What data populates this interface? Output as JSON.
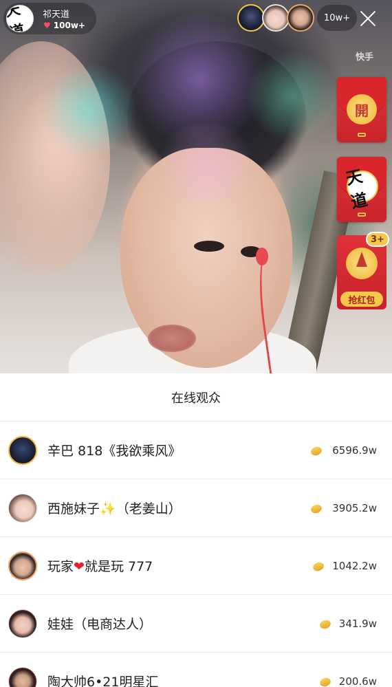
{
  "anchor": {
    "name": "祁天道",
    "likes": "100w+",
    "avatar_glyph": "天道"
  },
  "top_viewers": {
    "count": "10w+"
  },
  "watermark": "快手",
  "envelopes": {
    "open_label": "開",
    "grab_label": "抢红包",
    "grab_badge": "3+"
  },
  "audience": {
    "title": "在线观众",
    "rows": [
      {
        "name": "辛巴 818《我欲乘风》",
        "score": "6596.9w"
      },
      {
        "name_before": "西施妹子",
        "sparkle": "✨",
        "name_after": "（老姜山）",
        "score": "3905.2w"
      },
      {
        "name_before": "玩家",
        "heart": "❤",
        "name_after": "就是玩 777",
        "score": "1042.2w"
      },
      {
        "name": "娃娃（电商达人）",
        "score": "341.9w"
      },
      {
        "name": "陶大帅6•21明星汇",
        "score": "200.6w"
      }
    ]
  },
  "colors": {
    "envelope_red": "#d9262d",
    "gold": "#f5c84b",
    "heart": "#ff4d5e"
  },
  "icons": [
    "heart-icon",
    "close-icon",
    "coin-icon",
    "compass-icon",
    "sparkle-icon"
  ]
}
